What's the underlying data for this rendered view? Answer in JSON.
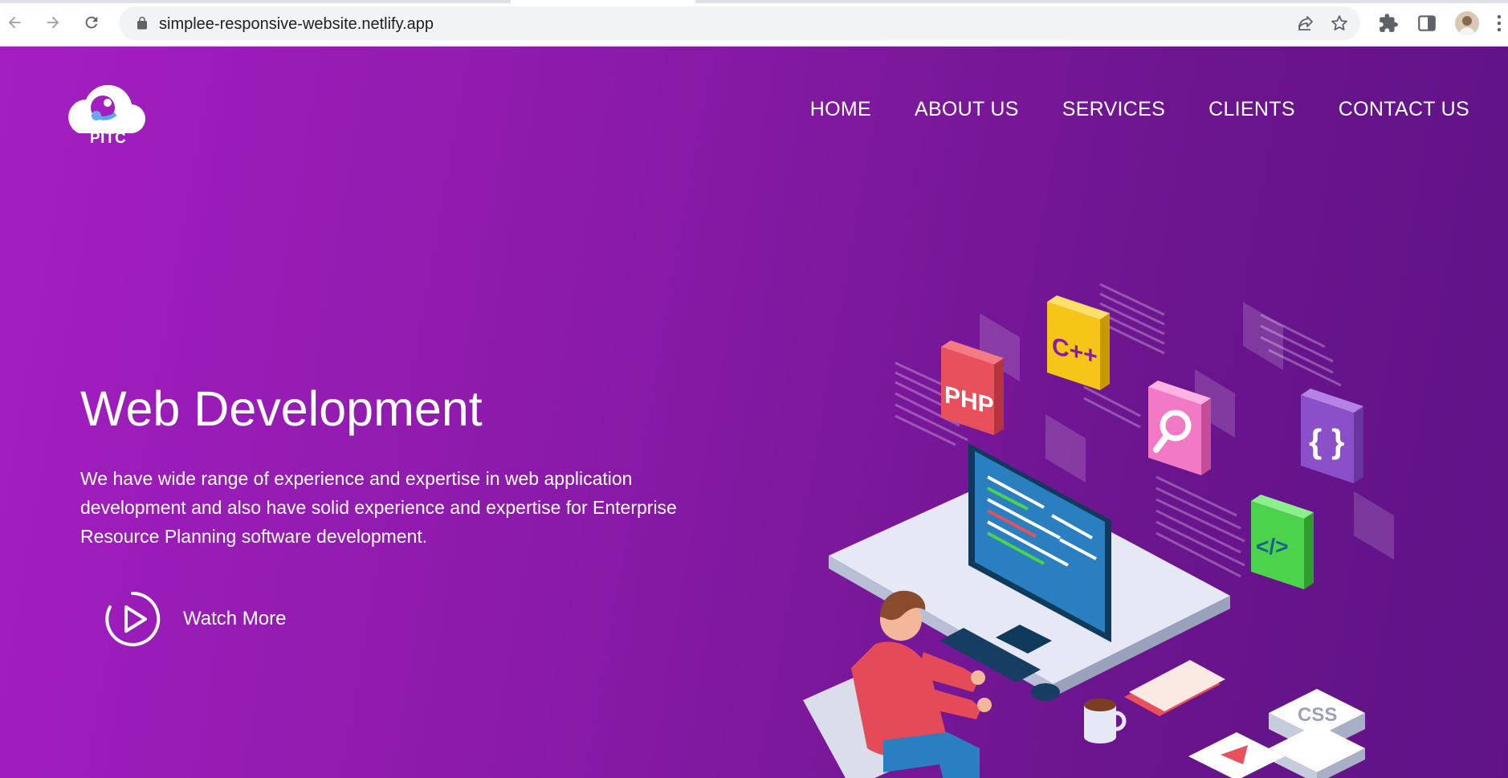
{
  "browser": {
    "url": "simplee-responsive-website.netlify.app"
  },
  "site": {
    "logo_text": "PITC",
    "nav": [
      "HOME",
      "ABOUT US",
      "SERVICES",
      "CLIENTS",
      "CONTACT US"
    ]
  },
  "hero": {
    "title": "Web Development",
    "description": "We have wide range of experience and expertise in web application development and also have solid experience and expertise for Enterprise Resource Planning software development.",
    "cta_label": "Watch More"
  },
  "illustration": {
    "tiles": [
      "PHP",
      "C++",
      "{ }",
      "</>",
      "CSS"
    ]
  },
  "colors": {
    "accent_start": "#a41ec2",
    "accent_end": "#5f1286",
    "php": "#e8505b",
    "cpp": "#f5c518",
    "search": "#f27ac5",
    "braces": "#8b4fc9",
    "code": "#4cd34c"
  }
}
